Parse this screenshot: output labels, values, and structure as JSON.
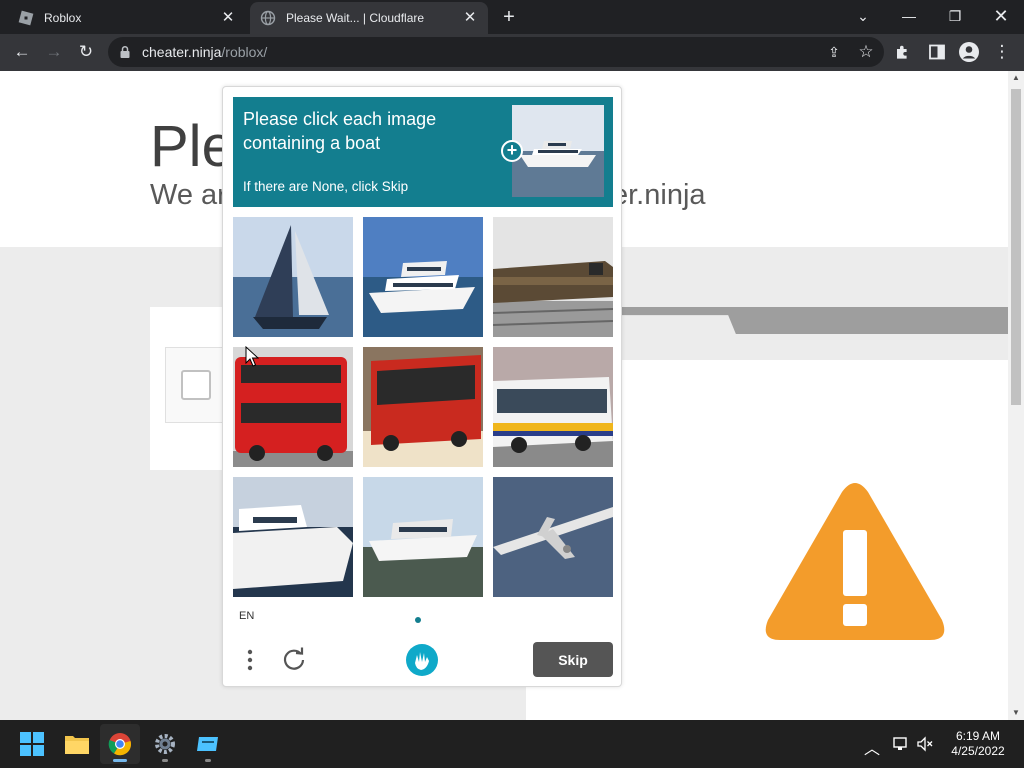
{
  "browser": {
    "tabs": [
      {
        "title": "Roblox",
        "favicon": "roblox-icon",
        "active": false
      },
      {
        "title": "Please Wait... | Cloudflare",
        "favicon": "globe-icon",
        "active": true
      }
    ],
    "url_host": "cheater.ninja",
    "url_path": "/roblox/"
  },
  "page": {
    "heading": "Ple",
    "subheading_start": "We ar",
    "subheading_end": "er.ninja",
    "warning_color": "#f39c2b"
  },
  "captcha": {
    "prompt": "Please click each image containing a boat",
    "hint": "If there are None, click Skip",
    "example_icon": "boat-example-image",
    "tiles": [
      {
        "label": "sailboat",
        "icon": "sailboat-image"
      },
      {
        "label": "yacht",
        "icon": "yacht-image"
      },
      {
        "label": "train",
        "icon": "train-image"
      },
      {
        "label": "red double-decker bus",
        "icon": "bus-image"
      },
      {
        "label": "red bus",
        "icon": "bus-image"
      },
      {
        "label": "white bus",
        "icon": "bus-image"
      },
      {
        "label": "motor yacht",
        "icon": "yacht-image"
      },
      {
        "label": "motor boat",
        "icon": "yacht-image"
      },
      {
        "label": "airplane",
        "icon": "airplane-image"
      }
    ],
    "language": "EN",
    "skip_label": "Skip",
    "accent": "#137e8f"
  },
  "taskbar": {
    "time": "6:19 AM",
    "date": "4/25/2022"
  }
}
